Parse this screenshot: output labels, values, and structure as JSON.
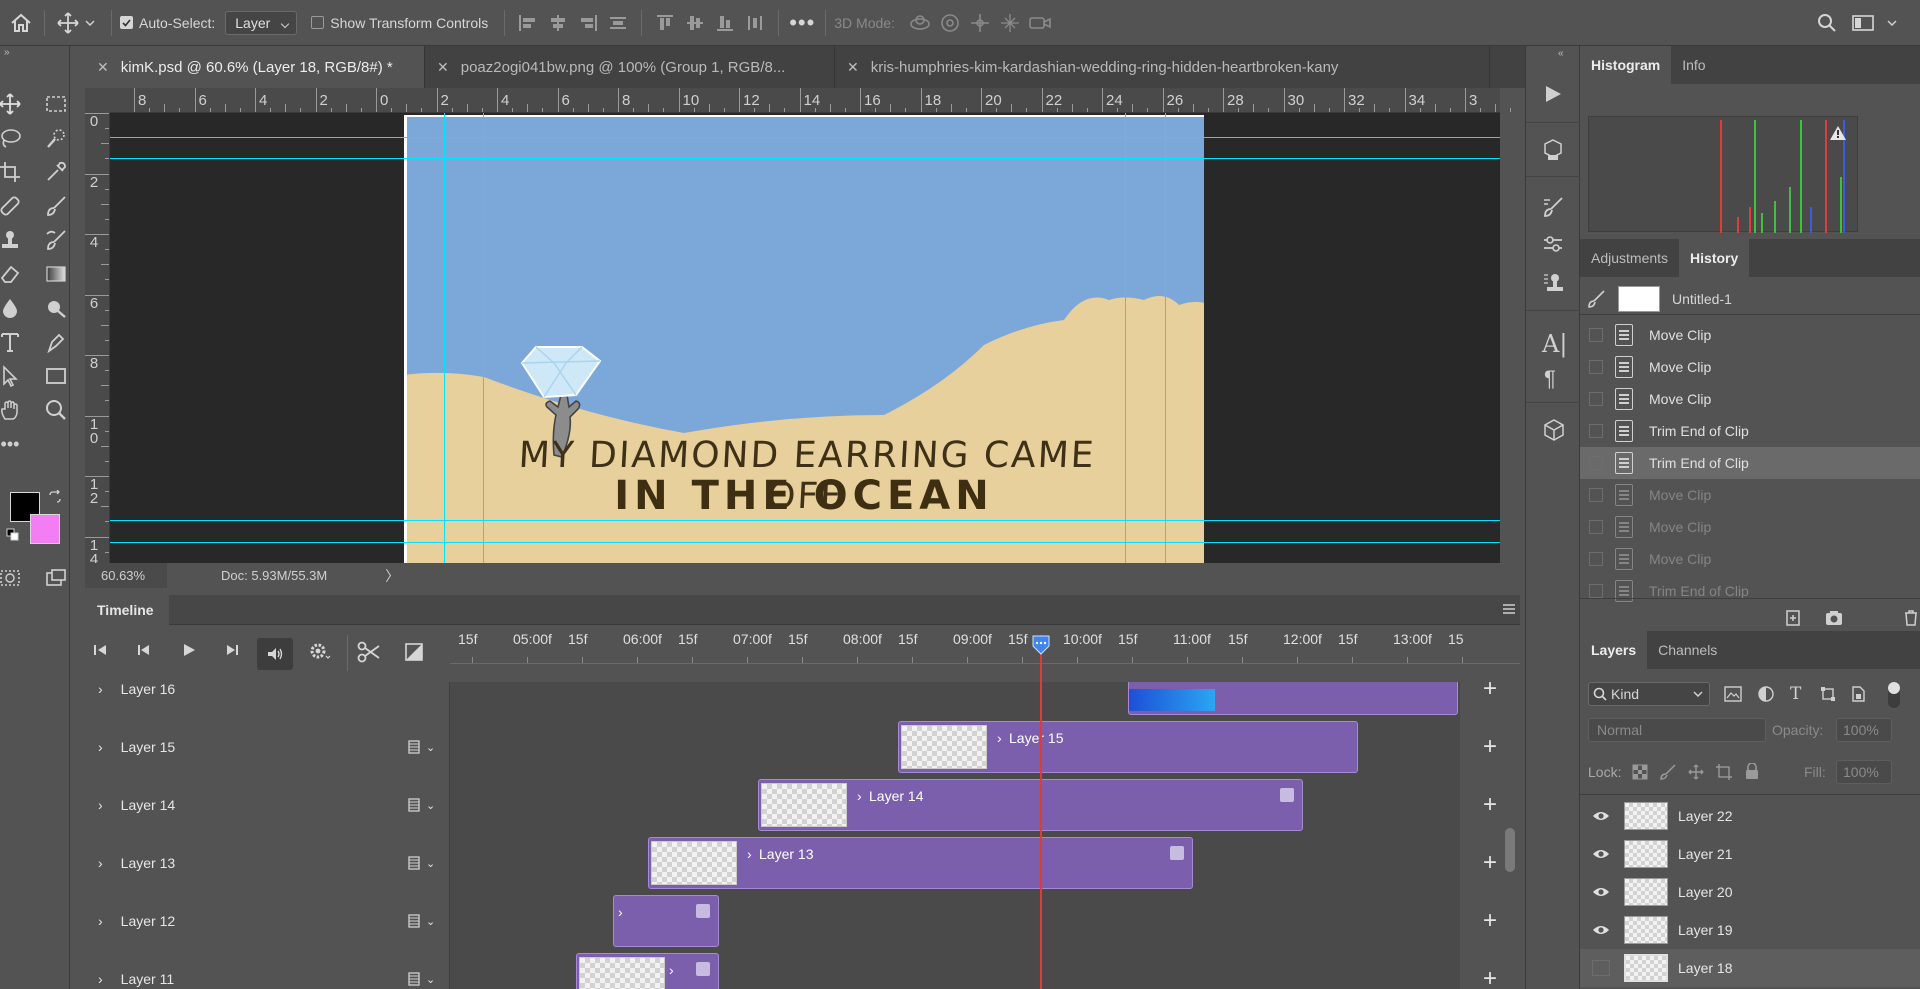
{
  "options_bar": {
    "auto_select_label": "Auto-Select:",
    "auto_select_value": "Layer",
    "show_transform_label": "Show Transform Controls",
    "mode_3d_label": "3D Mode:"
  },
  "tabs": [
    {
      "label": "kimK.psd @ 60.6% (Layer 18, RGB/8#) *"
    },
    {
      "label": "poaz2ogi041bw.png @ 100% (Group 1, RGB/8..."
    },
    {
      "label": "kris-humphries-kim-kardashian-wedding-ring-hidden-heartbroken-kany"
    }
  ],
  "ruler_h": [
    "8",
    "6",
    "4",
    "2",
    "0",
    "2",
    "4",
    "6",
    "8",
    "10",
    "12",
    "14",
    "16",
    "18",
    "20",
    "22",
    "24",
    "26",
    "28",
    "30",
    "32",
    "34",
    "3"
  ],
  "ruler_v": [
    "0",
    "2",
    "4",
    "6",
    "8",
    "1\n0",
    "1\n2",
    "1\n4"
  ],
  "artwork": {
    "line1": "MY DIAMOND EARRING CAME OFF",
    "line2": "IN THE OCEAN"
  },
  "status": {
    "zoom": "60.63%",
    "doc": "Doc: 5.93M/55.3M"
  },
  "timeline": {
    "title": "Timeline",
    "ruler_labels": [
      "15f",
      "05:00f",
      "15f",
      "06:00f",
      "15f",
      "07:00f",
      "15f",
      "08:00f",
      "15f",
      "09:00f",
      "15f",
      "10:00f",
      "15f",
      "11:00f",
      "15f",
      "12:00f",
      "15f",
      "13:00f",
      "15"
    ]
  },
  "timeline_layers": [
    {
      "name": "Layer 16",
      "clip_label": ""
    },
    {
      "name": "Layer 15",
      "clip_label": "Layer 15"
    },
    {
      "name": "Layer 14",
      "clip_label": "Layer 14"
    },
    {
      "name": "Layer 13",
      "clip_label": "Layer 13"
    },
    {
      "name": "Layer 12",
      "clip_label": ""
    },
    {
      "name": "Layer 11",
      "clip_label": ""
    }
  ],
  "panel_top": {
    "tab1": "Histogram",
    "tab2": "Info"
  },
  "panel_mid": {
    "tab1": "Adjustments",
    "tab2": "History"
  },
  "history": {
    "snapshot": "Untitled-1",
    "items": [
      {
        "label": "Move Clip",
        "state": "normal"
      },
      {
        "label": "Move Clip",
        "state": "normal"
      },
      {
        "label": "Move Clip",
        "state": "normal"
      },
      {
        "label": "Trim End of Clip",
        "state": "normal"
      },
      {
        "label": "Trim End of Clip",
        "state": "selected"
      },
      {
        "label": "Move Clip",
        "state": "disabled"
      },
      {
        "label": "Move Clip",
        "state": "disabled"
      },
      {
        "label": "Move Clip",
        "state": "disabled"
      },
      {
        "label": "Trim End of Clip",
        "state": "disabled"
      }
    ]
  },
  "layers_panel": {
    "tab1": "Layers",
    "tab2": "Channels",
    "filter": "Kind",
    "blend": "Normal",
    "opacity_label": "Opacity:",
    "opacity_value": "100%",
    "lock_label": "Lock:",
    "fill_label": "Fill:",
    "fill_value": "100%",
    "layers": [
      "Layer 22",
      "Layer 21",
      "Layer 20",
      "Layer 19",
      "Layer 18"
    ]
  },
  "colors": {
    "foreground": "#000000",
    "background": "#f37ef3",
    "guide": "#00e5ff",
    "clip": "#7b5fad",
    "playhead": "#e0393e",
    "sky": "#7ba7d9",
    "sand": "#e8d09c"
  }
}
